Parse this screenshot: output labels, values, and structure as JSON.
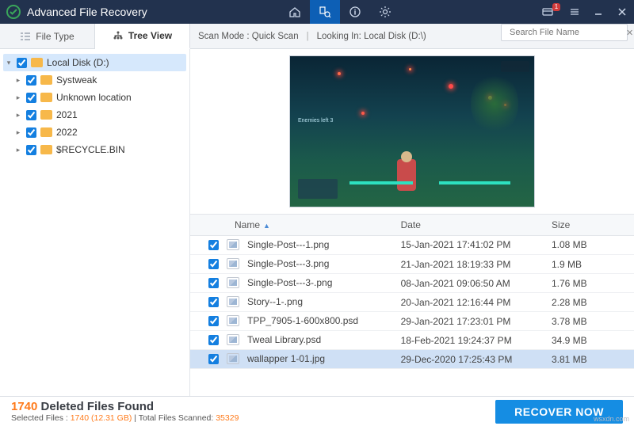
{
  "app": {
    "title": "Advanced File Recovery",
    "notif_badge": "1"
  },
  "tabs": {
    "file_type": "File Type",
    "tree_view": "Tree View"
  },
  "scanbar": {
    "scan_mode_label": "Scan Mode :",
    "scan_mode_value": "Quick Scan",
    "looking_label": "Looking In:",
    "looking_value": "Local Disk (D:\\)",
    "search_placeholder": "Search File Name"
  },
  "tree": {
    "root": "Local Disk (D:)",
    "children": [
      {
        "label": "Systweak"
      },
      {
        "label": "Unknown location"
      },
      {
        "label": "2021"
      },
      {
        "label": "2022"
      },
      {
        "label": "$RECYCLE.BIN"
      }
    ]
  },
  "preview_hud": {
    "enemies": "Enemies left   3"
  },
  "columns": {
    "name": "Name",
    "date": "Date",
    "size": "Size"
  },
  "files": [
    {
      "name": "Single-Post---1.png",
      "date": "15-Jan-2021 17:41:02 PM",
      "size": "1.08 MB",
      "selected": false
    },
    {
      "name": "Single-Post---3.png",
      "date": "21-Jan-2021 18:19:33 PM",
      "size": "1.9 MB",
      "selected": false
    },
    {
      "name": "Single-Post---3-.png",
      "date": "08-Jan-2021 09:06:50 AM",
      "size": "1.76 MB",
      "selected": false
    },
    {
      "name": "Story--1-.png",
      "date": "20-Jan-2021 12:16:44 PM",
      "size": "2.28 MB",
      "selected": false
    },
    {
      "name": "TPP_7905-1-600x800.psd",
      "date": "29-Jan-2021 17:23:01 PM",
      "size": "3.78 MB",
      "selected": false
    },
    {
      "name": "Tweal Library.psd",
      "date": "18-Feb-2021 19:24:37 PM",
      "size": "34.9 MB",
      "selected": false
    },
    {
      "name": "wallapper 1-01.jpg",
      "date": "29-Dec-2020 17:25:43 PM",
      "size": "3.81 MB",
      "selected": true
    }
  ],
  "footer": {
    "count": "1740",
    "title_rest": " Deleted Files Found",
    "sub_selected_label": "Selected Files :",
    "sub_selected_value": "1740 (12.31 GB)",
    "sub_total_label": "Total Files Scanned:",
    "sub_total_value": "35329",
    "recover": "RECOVER NOW"
  },
  "watermark": "wsxdn.com"
}
